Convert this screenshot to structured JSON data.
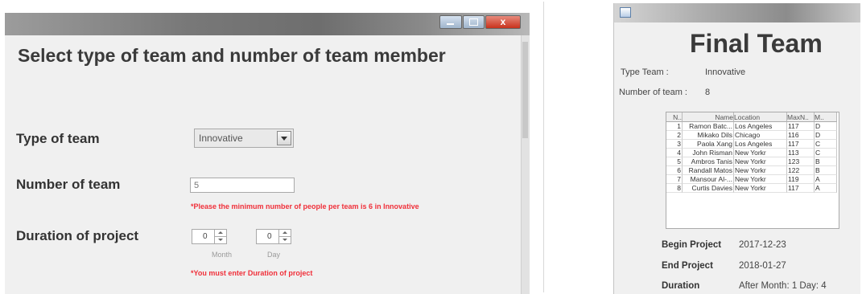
{
  "left_window": {
    "title": "Select type of team and number of team member",
    "close_glyph": "x",
    "type_label": "Type of team",
    "type_value": "Innovative",
    "number_label": "Number of team",
    "number_value": "5",
    "min_error": "*Please the minimum number of people per team is 6 in Innovative",
    "duration_label": "Duration of project",
    "month_value": "0",
    "day_value": "0",
    "month_label": "Month",
    "day_label": "Day",
    "duration_error": "*You must enter Duration of project",
    "error_color": "#f0303a"
  },
  "right_window": {
    "title": "Final Team",
    "type_team_label": "Type Team :",
    "type_team_value": "Innovative",
    "number_label": "Number of team :",
    "number_value": "8",
    "table": {
      "headers": [
        "N..",
        "Name",
        "Location",
        "MaxN..",
        "M.."
      ],
      "rows": [
        [
          "1",
          "Ramon Batc...",
          "Los Angeles",
          "117",
          "D"
        ],
        [
          "2",
          "Mikako Dils",
          "Chicago",
          "116",
          "D"
        ],
        [
          "3",
          "Paola Xang",
          "Los Angeles",
          "117",
          "C"
        ],
        [
          "4",
          "John Risman",
          "New Yorkr",
          "113",
          "C"
        ],
        [
          "5",
          "Ambros Tanis",
          "New Yorkr",
          "123",
          "B"
        ],
        [
          "6",
          "Randall Matos",
          "New Yorkr",
          "122",
          "B"
        ],
        [
          "7",
          "Mansour Al-...",
          "New Yorkr",
          "119",
          "A"
        ],
        [
          "8",
          "Curtis Davies",
          "New Yorkr",
          "117",
          "A"
        ]
      ]
    },
    "begin_label": "Begin Project",
    "begin_value": "2017-12-23",
    "end_label": "End Project",
    "end_value": "2018-01-27",
    "duration_label": "Duration",
    "duration_value": "After Month: 1 Day: 4"
  }
}
